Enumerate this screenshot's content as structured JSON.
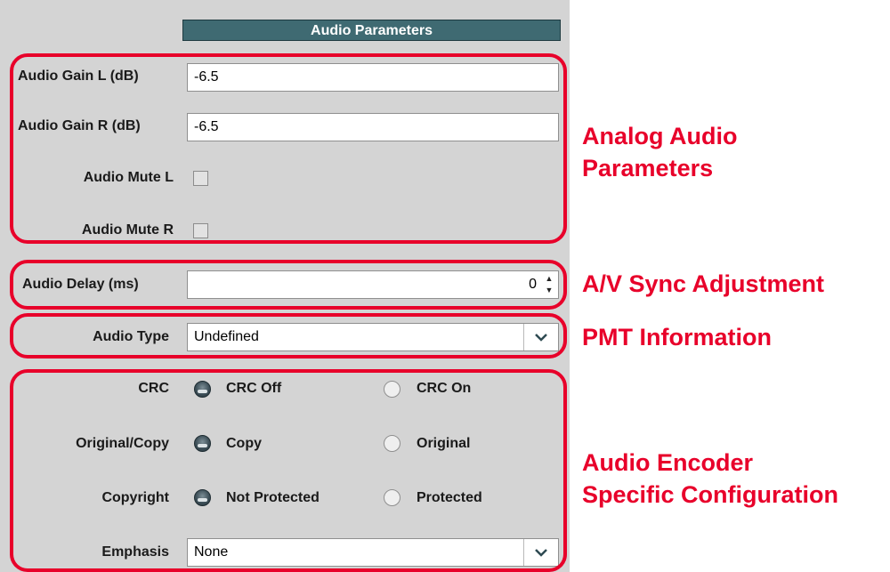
{
  "panel": {
    "title": "Audio Parameters",
    "gain_l": {
      "label": "Audio Gain L (dB)",
      "value": "-6.5"
    },
    "gain_r": {
      "label": "Audio Gain R (dB)",
      "value": "-6.5"
    },
    "mute_l": {
      "label": "Audio Mute L",
      "checked": false
    },
    "mute_r": {
      "label": "Audio Mute R",
      "checked": false
    },
    "delay": {
      "label": "Audio Delay (ms)",
      "value": "0"
    },
    "audio_type": {
      "label": "Audio Type",
      "value": "Undefined"
    },
    "crc": {
      "label": "CRC",
      "options": [
        "CRC Off",
        "CRC On"
      ],
      "selected": "CRC Off"
    },
    "original_copy": {
      "label": "Original/Copy",
      "options": [
        "Copy",
        "Original"
      ],
      "selected": "Copy"
    },
    "copyright": {
      "label": "Copyright",
      "options": [
        "Not Protected",
        "Protected"
      ],
      "selected": "Not Protected"
    },
    "emphasis": {
      "label": "Emphasis",
      "value": "None"
    }
  },
  "annotations": {
    "analog": [
      "Analog Audio",
      "Parameters"
    ],
    "sync": "A/V Sync Adjustment",
    "pmt": "PMT Information",
    "encoder": [
      "Audio Encoder",
      "Specific Configuration"
    ]
  },
  "colors": {
    "annotation": "#e8002a",
    "header": "#3f6a72",
    "panel": "#d4d4d4"
  }
}
